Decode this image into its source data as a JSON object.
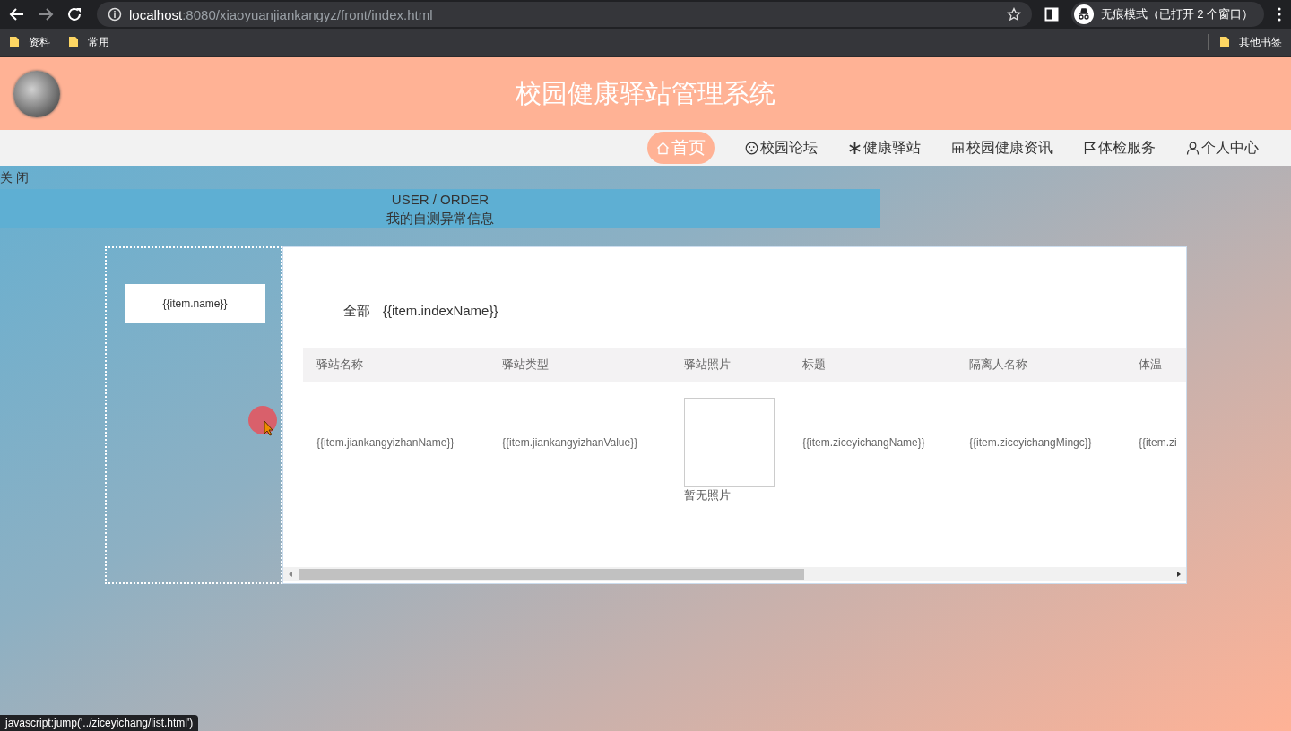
{
  "browser": {
    "url_host": "localhost",
    "url_path": ":8080/xiaoyuanjiankangyz/front/index.html",
    "forward_disabled": true,
    "incognito_label": "无痕模式（已打开 2 个窗口）",
    "bookmarks": [
      "资料",
      "常用"
    ],
    "other_bookmarks": "其他书签"
  },
  "header": {
    "title": "校园健康驿站管理系统"
  },
  "nav": [
    {
      "label": "首页",
      "selected": true
    },
    {
      "label": "校园论坛",
      "selected": false
    },
    {
      "label": "健康驿站",
      "selected": false
    },
    {
      "label": "校园健康资讯",
      "selected": false
    },
    {
      "label": "体检服务",
      "selected": false
    },
    {
      "label": "个人中心",
      "selected": false
    }
  ],
  "close_link": "关 闭",
  "banner": {
    "subtitle": "USER / ORDER",
    "title": "我的自测异常信息"
  },
  "sidebar": {
    "items": [
      {
        "label": "{{item.name}}"
      }
    ]
  },
  "filter": [
    {
      "label": "全部"
    },
    {
      "label": "{{item.indexName}}"
    }
  ],
  "table": {
    "columns": [
      "驿站名称",
      "驿站类型",
      "驿站照片",
      "标题",
      "隔离人名称",
      "体温"
    ],
    "rows": [
      {
        "cells": [
          "{{item.jiankangyizhanName}}",
          "{{item.jiankangyizhanValue}}",
          "",
          "{{item.ziceyichangName}}",
          "{{item.ziceyichangMingc}}",
          "{{item.zi"
        ],
        "photo_caption": "暂无照片"
      }
    ]
  },
  "status_link": "javascript:jump('../ziceyichang/list.html')"
}
